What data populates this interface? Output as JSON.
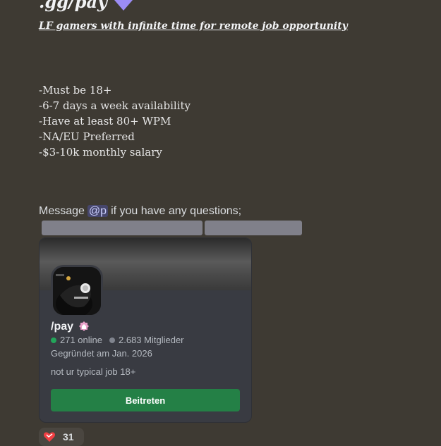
{
  "message": {
    "title": ".gg/pay",
    "subtitle": "LF gamers with infinite time for remote job opportunity",
    "requirements": [
      "-Must be 18+",
      "-6-7 days a week availability",
      "-Have at least 80+ WPM",
      "-NA/EU Preferred",
      "-$3-10k monthly salary"
    ],
    "contact_prefix": "Message",
    "mention": "@p",
    "contact_suffix": "if you have any questions;"
  },
  "invite_card": {
    "server_name": "/pay",
    "online_count": "271 online",
    "member_count": "2.683 Mitglieder",
    "founded": "Gegründet am Jan. 2026",
    "description": "not ur typical job 18+",
    "join_label": "Beitreten",
    "online_color": "#23a55a",
    "member_color": "#80848e",
    "button_color": "#248046"
  },
  "reaction": {
    "emoji": "heart-icon",
    "count": "31"
  }
}
